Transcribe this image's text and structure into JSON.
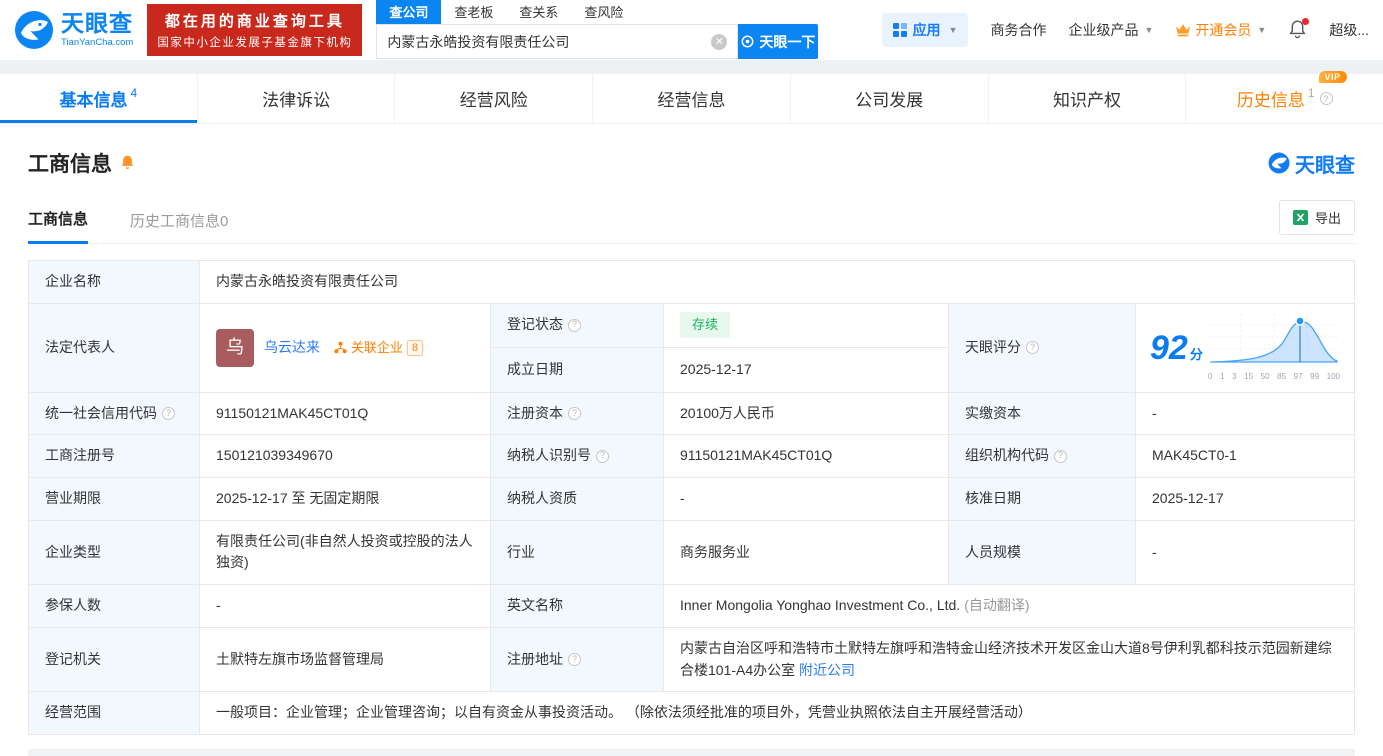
{
  "header": {
    "logo": {
      "title": "天眼查",
      "subtitle": "TianYanCha.com"
    },
    "promo": {
      "line1": "都在用的商业查询工具",
      "line2": "国家中小企业发展子基金旗下机构"
    },
    "search": {
      "tabs": [
        {
          "label": "查公司"
        },
        {
          "label": "查老板"
        },
        {
          "label": "查关系"
        },
        {
          "label": "查风险"
        }
      ],
      "value": "内蒙古永皓投资有限责任公司",
      "button": "天眼一下"
    },
    "nav": {
      "app": "应用",
      "cooperation": "商务合作",
      "enterprise": "企业级产品",
      "vip": "开通会员",
      "super": "超级..."
    }
  },
  "tabs": {
    "basic": {
      "label": "基本信息",
      "count": "4"
    },
    "legal": {
      "label": "法律诉讼"
    },
    "risk": {
      "label": "经营风险"
    },
    "business": {
      "label": "经营信息"
    },
    "development": {
      "label": "公司发展"
    },
    "ip": {
      "label": "知识产权"
    },
    "history": {
      "label": "历史信息",
      "count": "1",
      "vip": "VIP"
    }
  },
  "section": {
    "title": "工商信息",
    "brand": "天眼查",
    "subtab_active": "工商信息",
    "subtab_history": "历史工商信息0",
    "export": "导出"
  },
  "info": {
    "company_name": {
      "label": "企业名称",
      "value": "内蒙古永皓投资有限责任公司"
    },
    "legal_rep": {
      "label": "法定代表人",
      "avatar": "乌",
      "name": "乌云达来",
      "related_label": "关联企业",
      "related_count": "8"
    },
    "reg_status": {
      "label": "登记状态",
      "value": "存续"
    },
    "establish_date": {
      "label": "成立日期",
      "value": "2025-12-17"
    },
    "score": {
      "label": "天眼评分",
      "value": "92",
      "unit": "分",
      "axis": [
        "0",
        "1",
        "3",
        "15",
        "50",
        "85",
        "97",
        "99",
        "100"
      ]
    },
    "credit_code": {
      "label": "统一社会信用代码",
      "value": "91150121MAK45CT01Q"
    },
    "reg_capital": {
      "label": "注册资本",
      "value": "20100万人民币"
    },
    "paid_capital": {
      "label": "实缴资本",
      "value": "-"
    },
    "reg_number": {
      "label": "工商注册号",
      "value": "150121039349670"
    },
    "taxpayer_id": {
      "label": "纳税人识别号",
      "value": "91150121MAK45CT01Q"
    },
    "org_code": {
      "label": "组织机构代码",
      "value": "MAK45CT0-1"
    },
    "business_term": {
      "label": "营业期限",
      "value": "2025-12-17 至 无固定期限"
    },
    "taxpayer_quality": {
      "label": "纳税人资质",
      "value": "-"
    },
    "approval_date": {
      "label": "核准日期",
      "value": "2025-12-17"
    },
    "company_type": {
      "label": "企业类型",
      "value": "有限责任公司(非自然人投资或控股的法人独资)"
    },
    "industry": {
      "label": "行业",
      "value": "商务服务业"
    },
    "staff_size": {
      "label": "人员规模",
      "value": "-"
    },
    "insured_count": {
      "label": "参保人数",
      "value": "-"
    },
    "english_name": {
      "label": "英文名称",
      "value": "Inner Mongolia Yonghao Investment Co., Ltd.",
      "note": "(自动翻译)"
    },
    "reg_authority": {
      "label": "登记机关",
      "value": "土默特左旗市场监督管理局"
    },
    "reg_address": {
      "label": "注册地址",
      "value": "内蒙古自治区呼和浩特市土默特左旗呼和浩特金山经济技术开发区金山大道8号伊利乳都科技示范园新建综合楼101-A4办公室",
      "link": "附近公司"
    },
    "business_scope": {
      "label": "经营范围",
      "value": "一般项目：企业管理；企业管理咨询；以自有资金从事投资活动。 （除依法须经批准的项目外，凭营业执照依法自主开展经营活动）"
    }
  }
}
